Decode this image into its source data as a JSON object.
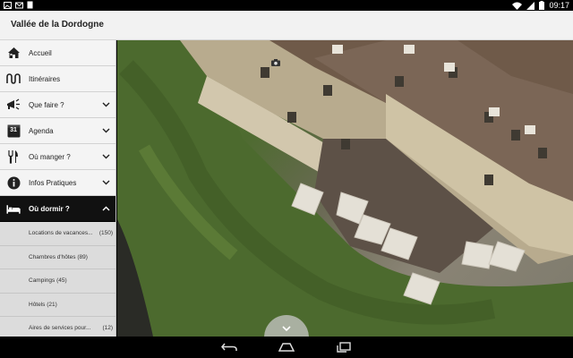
{
  "status_bar": {
    "time": "09:17"
  },
  "app_bar": {
    "title": "Vallée de la Dordogne"
  },
  "menu": [
    {
      "label": "Accueil",
      "icon": "house-icon",
      "chevron": false
    },
    {
      "label": "Itinéraires",
      "icon": "route-icon",
      "chevron": false
    },
    {
      "label": "Que faire ?",
      "icon": "megaphone-icon",
      "chevron": true
    },
    {
      "label": "Agenda",
      "icon": "calendar-icon",
      "calendar_day": "31",
      "chevron": true
    },
    {
      "label": "Où manger ?",
      "icon": "fork-knife-icon",
      "chevron": true
    },
    {
      "label": "Infos Pratiques",
      "icon": "info-icon",
      "chevron": true
    },
    {
      "label": "Où dormir ?",
      "icon": "bed-icon",
      "chevron": true,
      "expanded": true
    }
  ],
  "submenu": [
    {
      "label": "Locations de vacances...",
      "count": "(150)"
    },
    {
      "label": "Chambres d'hôtes (89)",
      "count": ""
    },
    {
      "label": "Campings (45)",
      "count": ""
    },
    {
      "label": "Hôtels (21)",
      "count": ""
    },
    {
      "label": "Aires de services pour...",
      "count": "(12)"
    }
  ],
  "colors": {
    "active_item": "#111111",
    "submenu_bg": "#dcdcdc",
    "appbar_bg": "#f2f2f2"
  }
}
